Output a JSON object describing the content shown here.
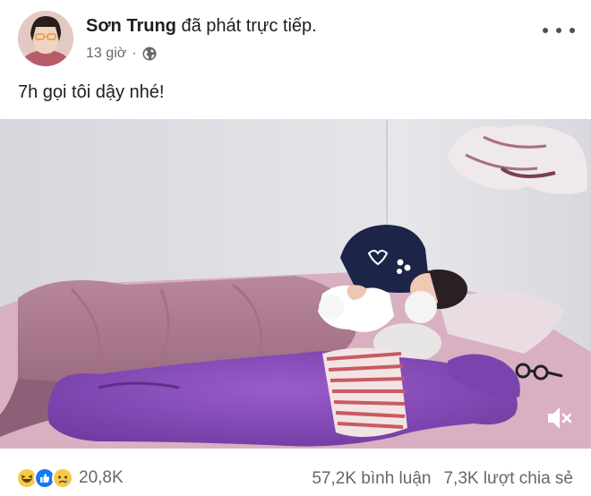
{
  "post": {
    "author_name": "Sơn Trung",
    "action_text": "đã phát trực tiếp.",
    "timestamp": "13 giờ",
    "separator": "·",
    "privacy_icon": "globe-icon",
    "more_icon": "more-dots-icon",
    "text": "7h gọi tôi dậy nhé!"
  },
  "video": {
    "mute_icon": "volume-muted-icon"
  },
  "footer": {
    "reaction_icons": [
      "haha-icon",
      "like-icon",
      "sad-icon"
    ],
    "reaction_count": "20,8K",
    "comments_text": "57,2K bình luận",
    "shares_text": "7,3K lượt chia sẻ"
  },
  "colors": {
    "text_primary": "#1c1e21",
    "text_secondary": "#65676b",
    "like_blue": "#1877f2",
    "reaction_yellow": "#f7c948"
  }
}
